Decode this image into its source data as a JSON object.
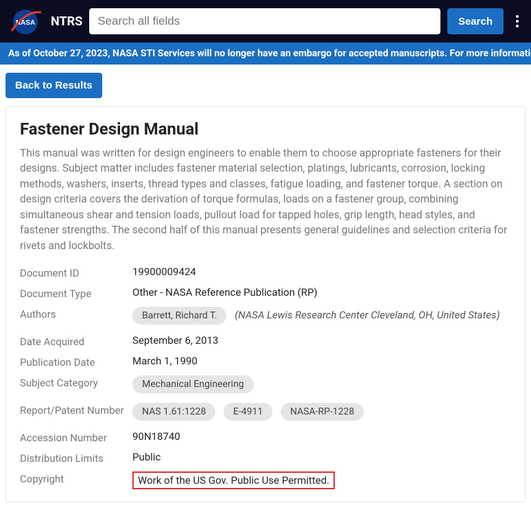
{
  "header": {
    "brand": "NTRS",
    "search_placeholder": "Search all fields",
    "search_button": "Search"
  },
  "banner": {
    "text": "As of October 27, 2023, NASA STI Services will no longer have an embargo for accepted manuscripts. For more informatio"
  },
  "nav": {
    "back_button": "Back to Results"
  },
  "document": {
    "title": "Fastener Design Manual",
    "abstract": "This manual was written for design engineers to enable them to choose appropriate fasteners for their designs. Subject matter includes fastener material selection, platings, lubricants, corrosion, locking methods, washers, inserts, thread types and classes, fatigue loading, and fastener torque. A section on design criteria covers the derivation of torque formulas, loads on a fastener group, combining simultaneous shear and tension loads, pullout load for tapped holes, grip length, head styles, and fastener strengths. The second half of this manual presents general guidelines and selection criteria for rivets and lockbolts."
  },
  "meta": {
    "labels": {
      "doc_id": "Document ID",
      "doc_type": "Document Type",
      "authors": "Authors",
      "date_acquired": "Date Acquired",
      "pub_date": "Publication Date",
      "subject": "Subject Category",
      "report_num": "Report/Patent Number",
      "accession": "Accession Number",
      "distribution": "Distribution Limits",
      "copyright": "Copyright"
    },
    "values": {
      "doc_id": "19900009424",
      "doc_type": "Other - NASA Reference Publication (RP)",
      "author_name": "Barrett, Richard T.",
      "author_affil": "(NASA Lewis Research Center Cleveland, OH, United States)",
      "date_acquired": "September 6, 2013",
      "pub_date": "March 1, 1990",
      "subject": "Mechanical Engineering",
      "report_nums": [
        "NAS 1.61:1228",
        "E-4911",
        "NASA-RP-1228"
      ],
      "accession": "90N18740",
      "distribution": "Public",
      "copyright": "Work of the US Gov. Public Use Permitted."
    }
  }
}
